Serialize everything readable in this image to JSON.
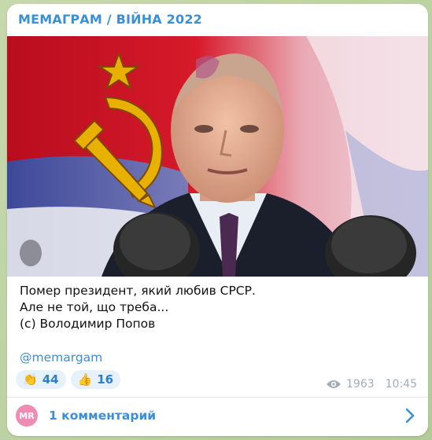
{
  "message": {
    "channel_name": "МЕМАГРАМ / ВІЙНА 2022",
    "caption_lines": [
      "Помер президент, який любив СРСР.",
      "Але не той, що треба...",
      "(с) Володимир Попов"
    ],
    "link": "@memargam",
    "reactions": [
      {
        "emoji_icon": "clapping-hands-icon",
        "emoji": "👏",
        "count": "44"
      },
      {
        "emoji_icon": "thumbs-up-icon",
        "emoji": "👍",
        "count": "16"
      }
    ],
    "views": "1963",
    "time": "10:45"
  },
  "comments": {
    "avatar_initials": "MR",
    "label": "1 комментарий"
  },
  "colors": {
    "accent": "#3a8fd6",
    "bubble": "#ffffff",
    "reaction_bg": "#e6f1fb",
    "avatar": "#f08bb3",
    "flag_red": "#c8102e",
    "emblem_gold": "#e8b000",
    "meta": "#a2acb6"
  }
}
